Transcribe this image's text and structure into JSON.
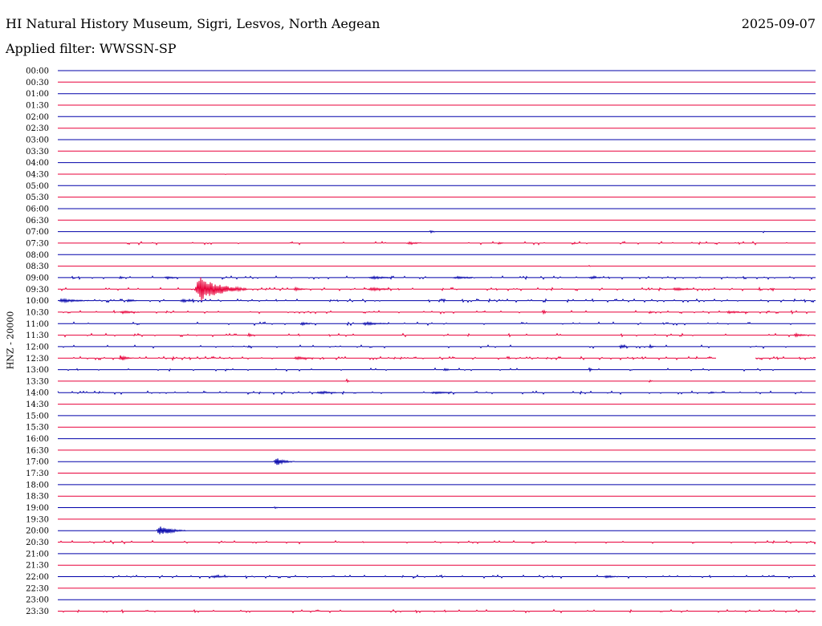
{
  "header": {
    "station": "HI Natural History Museum, Sigri, Lesvos, North Aegean",
    "date": "2025-09-07",
    "filter_label": "Applied filter: WWSSN-SP"
  },
  "side_label": "HNZ - 20000",
  "colors": {
    "odd_line": "#0000aa",
    "even_line": "#e8003a",
    "background": "#ffffff",
    "text": "#000000"
  },
  "chart_data": {
    "type": "helicorder",
    "channel": "HNZ",
    "rows": [
      {
        "time": "00:00",
        "noise": 0,
        "events": []
      },
      {
        "time": "00:30",
        "noise": 0,
        "events": []
      },
      {
        "time": "01:00",
        "noise": 0,
        "events": []
      },
      {
        "time": "01:30",
        "noise": 0,
        "events": []
      },
      {
        "time": "02:00",
        "noise": 0,
        "events": []
      },
      {
        "time": "02:30",
        "noise": 0,
        "events": []
      },
      {
        "time": "03:00",
        "noise": 0,
        "events": []
      },
      {
        "time": "03:30",
        "noise": 0,
        "events": []
      },
      {
        "time": "04:00",
        "noise": 0,
        "events": []
      },
      {
        "time": "04:30",
        "noise": 0,
        "events": [
          {
            "t": 0.22,
            "amp": 1,
            "dur": 0.002
          }
        ]
      },
      {
        "time": "05:00",
        "noise": 0,
        "events": []
      },
      {
        "time": "05:30",
        "noise": 0,
        "events": []
      },
      {
        "time": "06:00",
        "noise": 0,
        "events": []
      },
      {
        "time": "06:30",
        "noise": 0,
        "events": []
      },
      {
        "time": "07:00",
        "noise": 0,
        "events": [
          {
            "t": 0.49,
            "amp": 2,
            "dur": 0.01
          },
          {
            "t": 0.93,
            "amp": 2,
            "dur": 0.004
          }
        ]
      },
      {
        "time": "07:30",
        "noise": 0.2,
        "events": [
          {
            "t": 0.46,
            "amp": 1.5,
            "dur": 0.035
          },
          {
            "t": 0.58,
            "amp": 1.5,
            "dur": 0.012
          },
          {
            "t": 0.68,
            "amp": 1.5,
            "dur": 0.01
          }
        ]
      },
      {
        "time": "08:00",
        "noise": 0,
        "events": []
      },
      {
        "time": "08:30",
        "noise": 0,
        "events": [
          {
            "t": 0.7,
            "amp": 2,
            "dur": 0.003
          }
        ]
      },
      {
        "time": "09:00",
        "noise": 0.4,
        "events": [
          {
            "t": 0.08,
            "amp": 2,
            "dur": 0.01
          },
          {
            "t": 0.14,
            "amp": 1.5,
            "dur": 0.03
          },
          {
            "t": 0.41,
            "amp": 2,
            "dur": 0.05
          },
          {
            "t": 0.52,
            "amp": 1.5,
            "dur": 0.06
          },
          {
            "t": 0.7,
            "amp": 1.5,
            "dur": 0.03
          }
        ]
      },
      {
        "time": "09:30",
        "noise": 0.4,
        "events": [
          {
            "t": 0.18,
            "amp": 18,
            "dur": 0.07
          },
          {
            "t": 0.31,
            "amp": 2,
            "dur": 0.025
          },
          {
            "t": 0.41,
            "amp": 2.5,
            "dur": 0.04
          },
          {
            "t": 0.81,
            "amp": 2,
            "dur": 0.04
          },
          {
            "t": 0.94,
            "amp": 1.5,
            "dur": 0.01
          }
        ]
      },
      {
        "time": "10:00",
        "noise": 0.5,
        "events": [
          {
            "t": 0.0,
            "amp": 2,
            "dur": 0.06
          },
          {
            "t": 0.09,
            "amp": 2,
            "dur": 0.02
          },
          {
            "t": 0.16,
            "amp": 1.5,
            "dur": 0.04
          }
        ]
      },
      {
        "time": "10:30",
        "noise": 0.4,
        "events": [
          {
            "t": 0.08,
            "amp": 2,
            "dur": 0.04
          },
          {
            "t": 0.64,
            "amp": 4,
            "dur": 0.006
          },
          {
            "t": 0.78,
            "amp": 2,
            "dur": 0.01
          },
          {
            "t": 0.88,
            "amp": 1.5,
            "dur": 0.05
          }
        ]
      },
      {
        "time": "11:00",
        "noise": 0.3,
        "events": [
          {
            "t": 0.32,
            "amp": 2,
            "dur": 0.025
          },
          {
            "t": 0.4,
            "amp": 2,
            "dur": 0.05
          }
        ]
      },
      {
        "time": "11:30",
        "noise": 0.2,
        "events": [
          {
            "t": 0.25,
            "amp": 2,
            "dur": 0.015
          },
          {
            "t": 0.97,
            "amp": 2,
            "dur": 0.03
          }
        ]
      },
      {
        "time": "12:00",
        "noise": 0.2,
        "events": [
          {
            "t": 0.25,
            "amp": 1.5,
            "dur": 0.01
          },
          {
            "t": 0.74,
            "amp": 2,
            "dur": 0.02
          },
          {
            "t": 0.78,
            "amp": 2.5,
            "dur": 0.012
          }
        ]
      },
      {
        "time": "12:30",
        "noise": 0.6,
        "gaps": [
          [
            0.87,
            0.92
          ]
        ],
        "events": [
          {
            "t": 0.08,
            "amp": 4,
            "dur": 0.02
          },
          {
            "t": 0.15,
            "amp": 3,
            "dur": 0.006
          },
          {
            "t": 0.31,
            "amp": 2,
            "dur": 0.04
          }
        ]
      },
      {
        "time": "13:00",
        "noise": 0.2,
        "events": [
          {
            "t": 0.22,
            "amp": 2,
            "dur": 0.006
          },
          {
            "t": 0.51,
            "amp": 2,
            "dur": 0.012
          },
          {
            "t": 0.7,
            "amp": 2.5,
            "dur": 0.01
          }
        ]
      },
      {
        "time": "13:30",
        "noise": 0,
        "events": [
          {
            "t": 0.38,
            "amp": 3,
            "dur": 0.006
          },
          {
            "t": 0.78,
            "amp": 1.5,
            "dur": 0.008
          }
        ]
      },
      {
        "time": "14:00",
        "noise": 0.35,
        "events": [
          {
            "t": 0.34,
            "amp": 1.5,
            "dur": 0.05
          },
          {
            "t": 0.49,
            "amp": 1.5,
            "dur": 0.06
          },
          {
            "t": 0.86,
            "amp": 1.5,
            "dur": 0.015
          }
        ]
      },
      {
        "time": "14:30",
        "noise": 0,
        "events": []
      },
      {
        "time": "15:00",
        "noise": 0,
        "events": []
      },
      {
        "time": "15:30",
        "noise": 0,
        "events": []
      },
      {
        "time": "16:00",
        "noise": 0,
        "events": []
      },
      {
        "time": "16:30",
        "noise": 0,
        "events": []
      },
      {
        "time": "17:00",
        "noise": 0,
        "events": [
          {
            "t": 0.285,
            "amp": 5,
            "dur": 0.03
          }
        ]
      },
      {
        "time": "17:30",
        "noise": 0,
        "events": []
      },
      {
        "time": "18:00",
        "noise": 0,
        "events": []
      },
      {
        "time": "18:30",
        "noise": 0,
        "events": []
      },
      {
        "time": "19:00",
        "noise": 0,
        "events": [
          {
            "t": 0.285,
            "amp": 1.5,
            "dur": 0.01
          }
        ]
      },
      {
        "time": "19:30",
        "noise": 0,
        "events": []
      },
      {
        "time": "20:00",
        "noise": 0,
        "events": [
          {
            "t": 0.13,
            "amp": 7,
            "dur": 0.04
          }
        ]
      },
      {
        "time": "20:30",
        "noise": 0.25,
        "events": []
      },
      {
        "time": "21:00",
        "noise": 0,
        "events": []
      },
      {
        "time": "21:30",
        "noise": 0,
        "events": []
      },
      {
        "time": "22:00",
        "noise": 0.4,
        "events": [
          {
            "t": 0.2,
            "amp": 1.5,
            "dur": 0.05
          },
          {
            "t": 0.72,
            "amp": 1.5,
            "dur": 0.03
          }
        ]
      },
      {
        "time": "22:30",
        "noise": 0,
        "events": []
      },
      {
        "time": "23:00",
        "noise": 0,
        "events": []
      },
      {
        "time": "23:30",
        "noise": 0.3,
        "events": []
      }
    ]
  }
}
